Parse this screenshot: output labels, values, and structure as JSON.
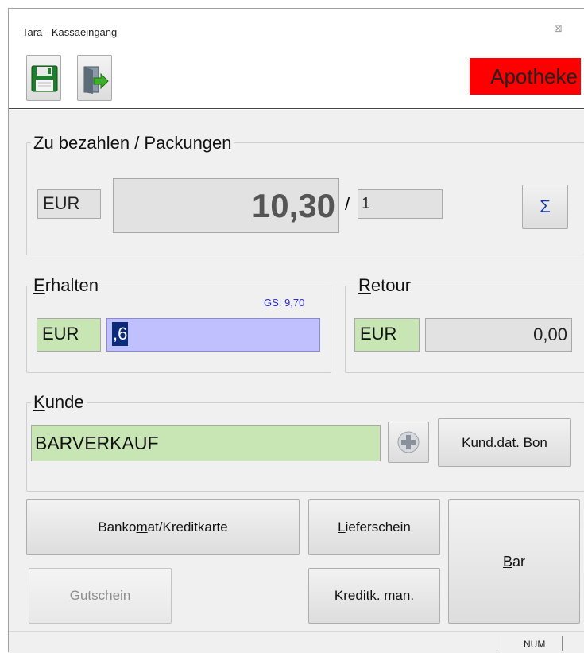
{
  "window": {
    "title": "Tara - Kassaeingang",
    "close_glyph": "⊠"
  },
  "toolbar": {
    "save_icon": "floppy-disk-icon",
    "exit_icon": "exit-door-icon",
    "badge": "Apotheke",
    "badge_color": "#ff0000"
  },
  "payment_due": {
    "legend": "Zu bezahlen / Packungen",
    "currency": "EUR",
    "amount": "10,30",
    "separator": "/",
    "packages": "1",
    "sum_button": "Σ"
  },
  "received": {
    "legend_hotkey": "E",
    "legend_rest": "rhalten",
    "voucher_info": "GS: 9,70",
    "currency": "EUR",
    "input_value": ",6",
    "input_bg": "#c0c0ff"
  },
  "change": {
    "legend_hotkey": "R",
    "legend_rest": "etour",
    "currency": "EUR",
    "value": "0,00"
  },
  "customer": {
    "legend_hotkey": "K",
    "legend_rest": "unde",
    "name": "BARVERKAUF",
    "add_icon": "plus-circle-icon",
    "receipt_button": "Kund.dat. Bon"
  },
  "actions": {
    "card": {
      "pre": "Banko",
      "hotkey": "m",
      "post": "at/Kreditkarte"
    },
    "delivery": {
      "pre": "",
      "hotkey": "L",
      "post": "ieferschein"
    },
    "cash": {
      "pre": "",
      "hotkey": "B",
      "post": "ar"
    },
    "voucher": {
      "pre": "",
      "hotkey": "G",
      "post": "utschein"
    },
    "credit_manual": {
      "pre": "Kreditk. ma",
      "hotkey": "n",
      "post": "."
    }
  },
  "statusbar": {
    "num": "NUM"
  },
  "colors": {
    "green_field": "#c7e6b4",
    "panel_bg": "#f0f0f0"
  }
}
